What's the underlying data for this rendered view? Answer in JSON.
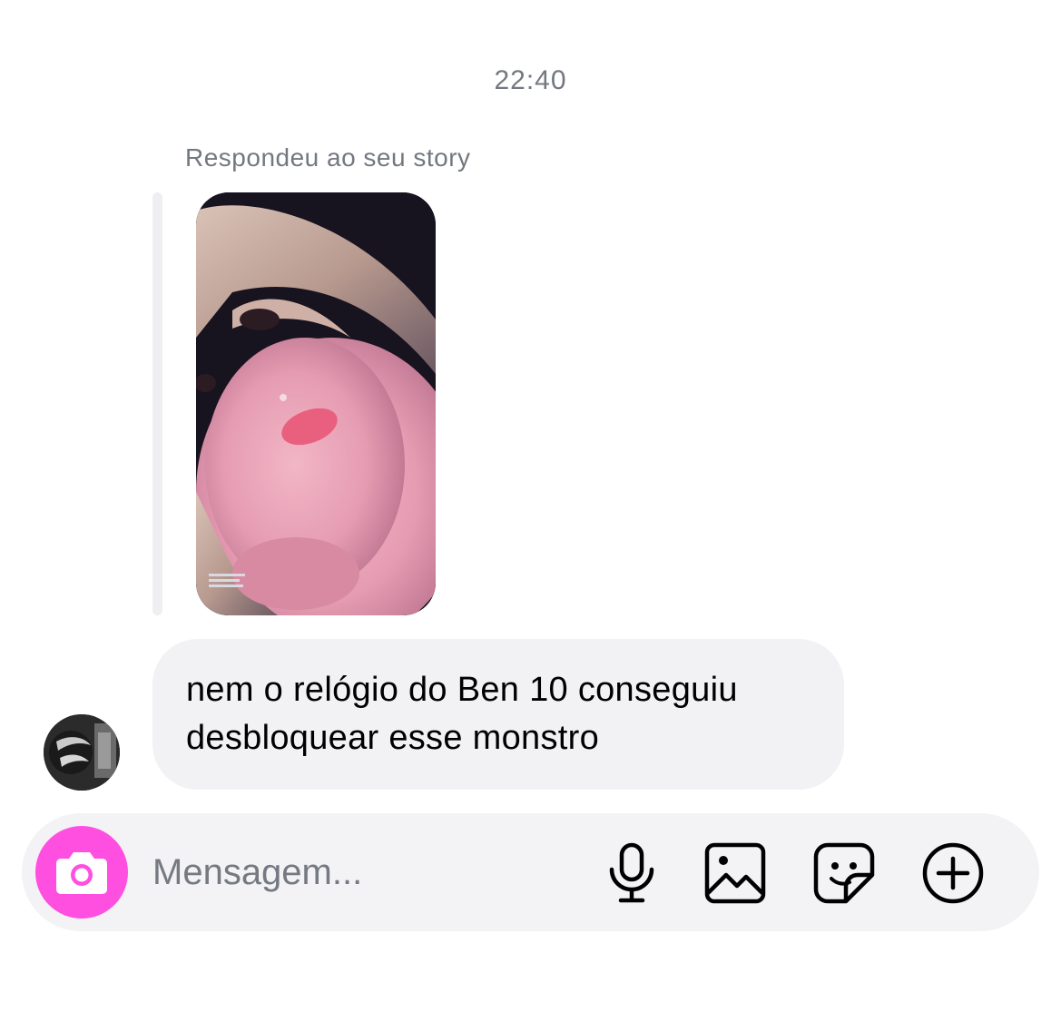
{
  "conversation": {
    "timestamp": "22:40",
    "reply_caption": "Respondeu ao seu story",
    "message_text": "nem o relógio do Ben 10 conseguiu desbloquear esse monstro"
  },
  "composer": {
    "placeholder": "Mensagem...",
    "icons": [
      "camera-icon",
      "microphone-icon",
      "gallery-icon",
      "sticker-icon",
      "plus-circle-icon"
    ]
  },
  "colors": {
    "camera_accent": "#ff4fe0",
    "bubble_bg": "#f2f2f5",
    "meta_text": "#737880"
  }
}
